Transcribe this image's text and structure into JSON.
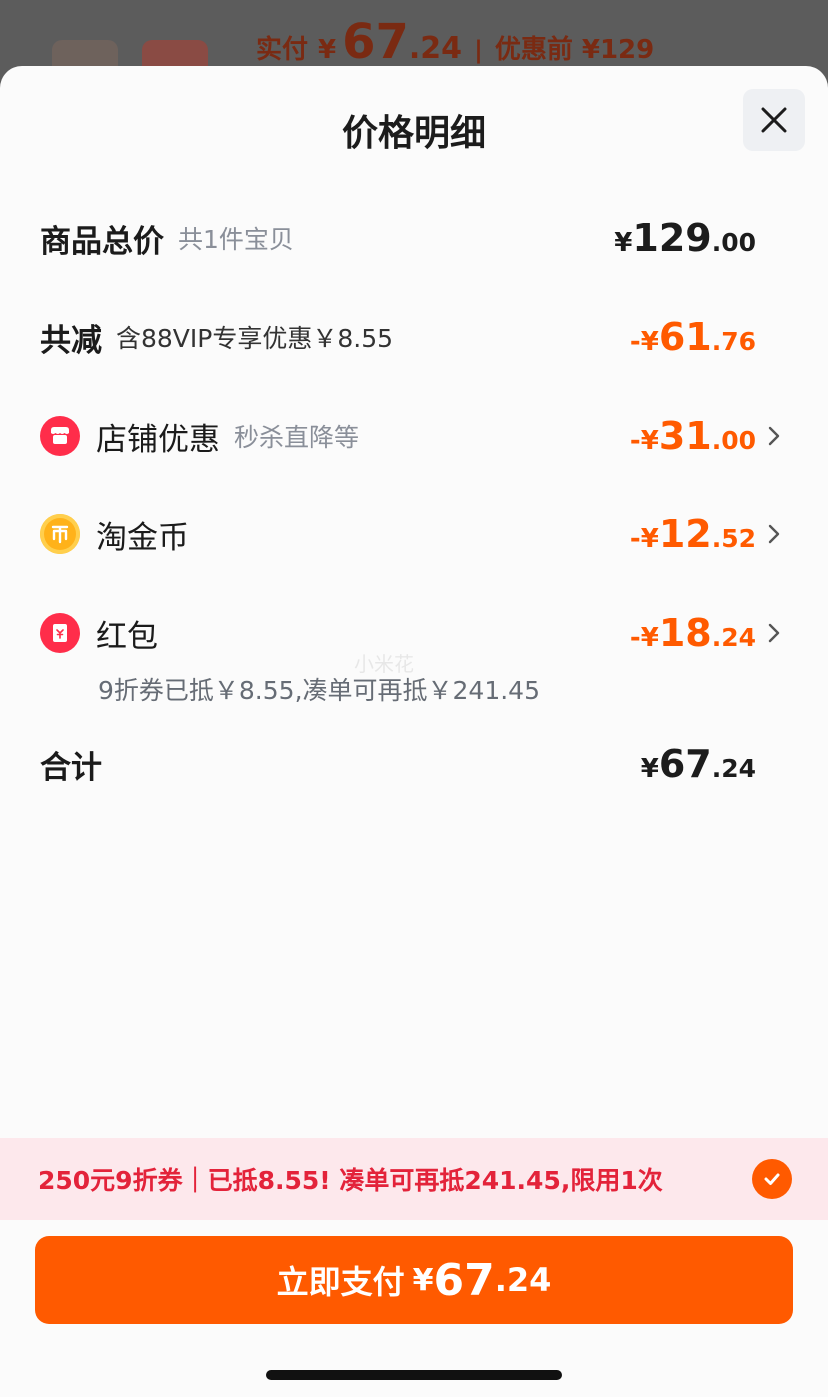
{
  "background": {
    "actual_label": "实付",
    "actual_currency": "¥",
    "actual_int": "67",
    "actual_dec": ".24",
    "separator": "|",
    "before_text": "优惠前 ¥129"
  },
  "sheet": {
    "title": "价格明细",
    "close_icon": "close-icon"
  },
  "rows": {
    "total": {
      "label": "商品总价",
      "sub": "共1件宝贝",
      "cur": "¥",
      "int": "129",
      "dec": ".00"
    },
    "reduction": {
      "label": "共减",
      "sub": "含88VIP专享优惠￥8.55",
      "cur": "-¥",
      "int": "61",
      "dec": ".76"
    },
    "shop": {
      "label": "店铺优惠",
      "sub": "秒杀直降等",
      "cur": "-¥",
      "int": "31",
      "dec": ".00",
      "icon": "shop-icon"
    },
    "coins": {
      "label": "淘金币",
      "cur": "-¥",
      "int": "12",
      "dec": ".52",
      "icon": "coin-icon"
    },
    "redpacket": {
      "label": "红包",
      "cur": "-¥",
      "int": "18",
      "dec": ".24",
      "icon": "red-packet-icon",
      "note": "9折券已抵￥8.55,凑单可再抵￥241.45"
    },
    "sum": {
      "label": "合计",
      "cur": "¥",
      "int": "67",
      "dec": ".24"
    }
  },
  "watermark": "小米花",
  "coupon": {
    "text": "250元9折券｜已抵8.55! 凑单可再抵241.45,限用1次",
    "checked": true
  },
  "pay_button": {
    "label": "立即支付",
    "cur": "¥",
    "int": "67",
    "dec": ".24"
  },
  "colors": {
    "accent": "#ff5a00",
    "coupon_text": "#e3233a",
    "coupon_bg": "#fde8ec"
  }
}
